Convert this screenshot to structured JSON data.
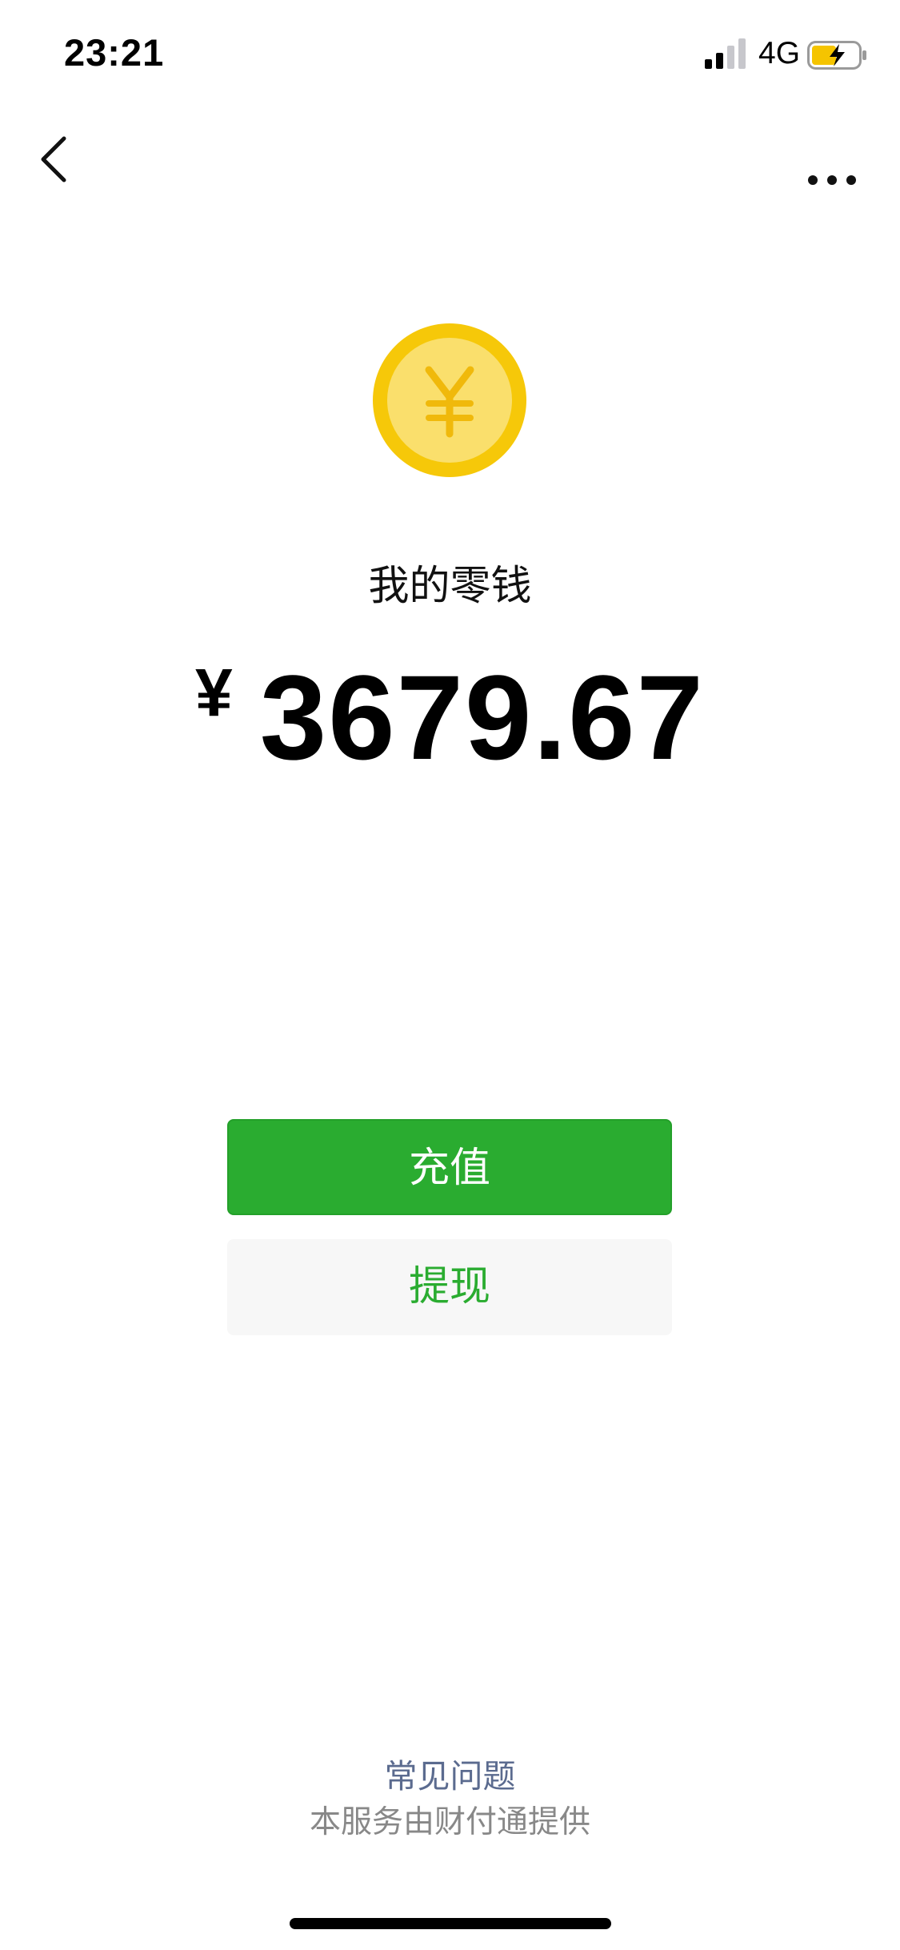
{
  "status_bar": {
    "time": "23:21",
    "network": "4G",
    "signal_icon": "signal-bars-icon",
    "battery_icon": "battery-charging-icon",
    "battery_color": "#f5c400"
  },
  "nav": {
    "back_icon": "chevron-left-icon",
    "more_icon": "ellipsis-icon"
  },
  "wallet": {
    "coin_icon": "yuan-coin-icon",
    "coin_color": "#f6c809",
    "title": "我的零钱",
    "currency_symbol": "¥",
    "amount": "3679.67"
  },
  "actions": {
    "recharge_label": "充值",
    "withdraw_label": "提现",
    "accent_color": "#2aac30"
  },
  "footer": {
    "faq_label": "常见问题",
    "service_note": "本服务由财付通提供"
  }
}
